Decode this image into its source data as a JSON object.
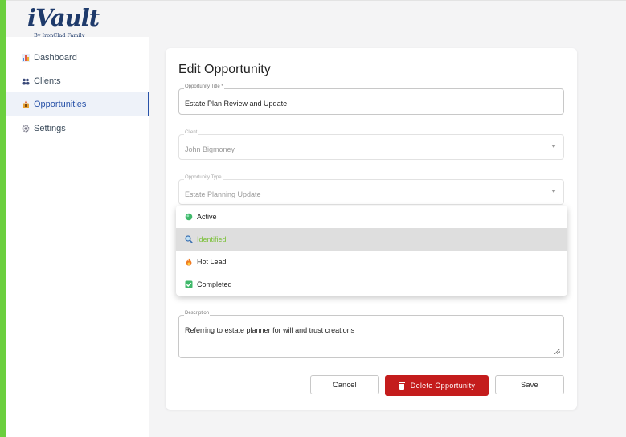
{
  "app": {
    "logo_text": "iVault",
    "logo_tagline": "By IronClad Family"
  },
  "sidebar": {
    "items": [
      {
        "label": "Dashboard",
        "icon": "bar-chart-icon"
      },
      {
        "label": "Clients",
        "icon": "people-icon"
      },
      {
        "label": "Opportunities",
        "icon": "opportunities-icon",
        "active": true
      },
      {
        "label": "Settings",
        "icon": "gear-icon"
      }
    ]
  },
  "form": {
    "title": "Edit Opportunity",
    "opportunity_title": {
      "label": "Opportunity Title *",
      "value": "Estate Plan Review and Update"
    },
    "client": {
      "label": "Client",
      "value": "John Bigmoney"
    },
    "opportunity_type": {
      "label": "Opportunity Type",
      "value": "Estate Planning Update"
    },
    "description": {
      "label": "Description",
      "value": "Referring to estate planner for will and trust creations"
    }
  },
  "status_dropdown": {
    "options": [
      {
        "label": "Active",
        "icon": "green-circle-icon"
      },
      {
        "label": "Identified",
        "icon": "magnifier-icon",
        "highlighted": true
      },
      {
        "label": "Hot Lead",
        "icon": "fire-icon"
      },
      {
        "label": "Completed",
        "icon": "check-box-icon"
      }
    ]
  },
  "buttons": {
    "cancel": "Cancel",
    "delete": "Delete Opportunity",
    "save": "Save"
  },
  "colors": {
    "accent_blue": "#2852a8",
    "danger": "#c41c1c",
    "highlight_text": "#7cc13a",
    "side_stripe": "#6bcf3e"
  }
}
